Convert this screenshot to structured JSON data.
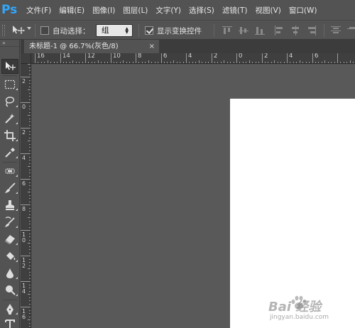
{
  "app": {
    "logo": "Ps"
  },
  "menu": [
    "文件(F)",
    "编辑(E)",
    "图像(I)",
    "图层(L)",
    "文字(Y)",
    "选择(S)",
    "滤镜(T)",
    "视图(V)",
    "窗口(W)"
  ],
  "options": {
    "tool_icon": "move-tool-icon",
    "auto_select_label": "自动选择：",
    "auto_select_checked": false,
    "auto_select_value": "组",
    "show_transform_label": "显示变换控件",
    "show_transform_checked": true
  },
  "document": {
    "tab_title": "未标题-1 @ 66.7%(灰色/8)",
    "close_glyph": "×"
  },
  "rulers": {
    "horizontal": [
      "16",
      "14",
      "12",
      "10",
      "8",
      "6",
      "4",
      "2",
      "0",
      "2",
      "4",
      "6"
    ],
    "vertical": [
      "2",
      "0",
      "2",
      "4",
      "6",
      "8",
      "1\n0",
      "1\n2",
      "1\n4",
      "1\n6"
    ]
  },
  "toolbox": {
    "tools": [
      "move-tool",
      "marquee-tool",
      "lasso-tool",
      "magic-wand-tool",
      "crop-tool",
      "eyedropper-tool",
      "healing-brush-tool",
      "brush-tool",
      "clone-stamp-tool",
      "history-brush-tool",
      "eraser-tool",
      "paint-bucket-tool",
      "blur-tool",
      "dodge-tool",
      "pen-tool",
      "type-tool"
    ]
  },
  "watermark": {
    "brand": "Bai 经验",
    "url": "jingyan.baidu.com"
  },
  "colors": {
    "interface": "#535353",
    "pasteboard": "#595959",
    "ruler": "#3f3f3f",
    "document_fill": "#ffffff",
    "ps_logo": "#31a8ff"
  }
}
